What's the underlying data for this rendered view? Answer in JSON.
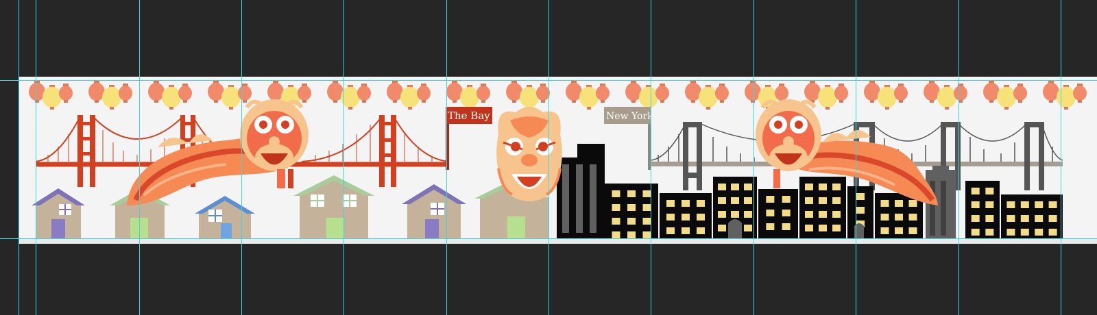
{
  "canvas": {
    "background": "#262626",
    "artboard_color": "#f4f4f4",
    "guide_color": "#3fd6e0"
  },
  "signs": {
    "bay": {
      "label": "The Bay",
      "color": "#c2331c"
    },
    "ny": {
      "label": "New York",
      "color": "#a89c8d"
    }
  },
  "palette": {
    "lantern_red": "#f08a6a",
    "lantern_yellow": "#f7e27a",
    "golden_gate": "#d2401f",
    "ny_bridge": "#5a5a5a",
    "house_body": "#c4b29a",
    "building": "#0a0a0a",
    "window": "#f3dc89",
    "lion_orange": "#f58a55",
    "lion_peach": "#f8c48e"
  },
  "icons": [
    "lantern-icon",
    "golden-gate-bridge-icon",
    "brooklyn-bridge-icon",
    "house-icon",
    "building-icon",
    "lion-dance-head-icon",
    "lion-dance-body-icon",
    "flag-sign-icon"
  ]
}
